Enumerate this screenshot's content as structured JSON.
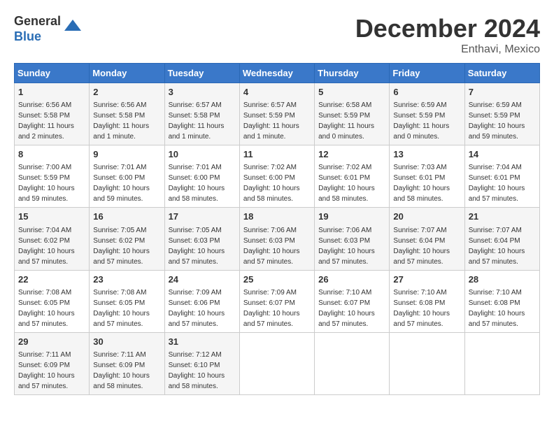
{
  "header": {
    "logo_general": "General",
    "logo_blue": "Blue",
    "month_title": "December 2024",
    "location": "Enthavi, Mexico"
  },
  "weekdays": [
    "Sunday",
    "Monday",
    "Tuesday",
    "Wednesday",
    "Thursday",
    "Friday",
    "Saturday"
  ],
  "weeks": [
    [
      {
        "day": "1",
        "sunrise": "6:56 AM",
        "sunset": "5:58 PM",
        "daylight": "11 hours and 2 minutes."
      },
      {
        "day": "2",
        "sunrise": "6:56 AM",
        "sunset": "5:58 PM",
        "daylight": "11 hours and 1 minute."
      },
      {
        "day": "3",
        "sunrise": "6:57 AM",
        "sunset": "5:58 PM",
        "daylight": "11 hours and 1 minute."
      },
      {
        "day": "4",
        "sunrise": "6:57 AM",
        "sunset": "5:59 PM",
        "daylight": "11 hours and 1 minute."
      },
      {
        "day": "5",
        "sunrise": "6:58 AM",
        "sunset": "5:59 PM",
        "daylight": "11 hours and 0 minutes."
      },
      {
        "day": "6",
        "sunrise": "6:59 AM",
        "sunset": "5:59 PM",
        "daylight": "11 hours and 0 minutes."
      },
      {
        "day": "7",
        "sunrise": "6:59 AM",
        "sunset": "5:59 PM",
        "daylight": "10 hours and 59 minutes."
      }
    ],
    [
      {
        "day": "8",
        "sunrise": "7:00 AM",
        "sunset": "5:59 PM",
        "daylight": "10 hours and 59 minutes."
      },
      {
        "day": "9",
        "sunrise": "7:01 AM",
        "sunset": "6:00 PM",
        "daylight": "10 hours and 59 minutes."
      },
      {
        "day": "10",
        "sunrise": "7:01 AM",
        "sunset": "6:00 PM",
        "daylight": "10 hours and 58 minutes."
      },
      {
        "day": "11",
        "sunrise": "7:02 AM",
        "sunset": "6:00 PM",
        "daylight": "10 hours and 58 minutes."
      },
      {
        "day": "12",
        "sunrise": "7:02 AM",
        "sunset": "6:01 PM",
        "daylight": "10 hours and 58 minutes."
      },
      {
        "day": "13",
        "sunrise": "7:03 AM",
        "sunset": "6:01 PM",
        "daylight": "10 hours and 58 minutes."
      },
      {
        "day": "14",
        "sunrise": "7:04 AM",
        "sunset": "6:01 PM",
        "daylight": "10 hours and 57 minutes."
      }
    ],
    [
      {
        "day": "15",
        "sunrise": "7:04 AM",
        "sunset": "6:02 PM",
        "daylight": "10 hours and 57 minutes."
      },
      {
        "day": "16",
        "sunrise": "7:05 AM",
        "sunset": "6:02 PM",
        "daylight": "10 hours and 57 minutes."
      },
      {
        "day": "17",
        "sunrise": "7:05 AM",
        "sunset": "6:03 PM",
        "daylight": "10 hours and 57 minutes."
      },
      {
        "day": "18",
        "sunrise": "7:06 AM",
        "sunset": "6:03 PM",
        "daylight": "10 hours and 57 minutes."
      },
      {
        "day": "19",
        "sunrise": "7:06 AM",
        "sunset": "6:03 PM",
        "daylight": "10 hours and 57 minutes."
      },
      {
        "day": "20",
        "sunrise": "7:07 AM",
        "sunset": "6:04 PM",
        "daylight": "10 hours and 57 minutes."
      },
      {
        "day": "21",
        "sunrise": "7:07 AM",
        "sunset": "6:04 PM",
        "daylight": "10 hours and 57 minutes."
      }
    ],
    [
      {
        "day": "22",
        "sunrise": "7:08 AM",
        "sunset": "6:05 PM",
        "daylight": "10 hours and 57 minutes."
      },
      {
        "day": "23",
        "sunrise": "7:08 AM",
        "sunset": "6:05 PM",
        "daylight": "10 hours and 57 minutes."
      },
      {
        "day": "24",
        "sunrise": "7:09 AM",
        "sunset": "6:06 PM",
        "daylight": "10 hours and 57 minutes."
      },
      {
        "day": "25",
        "sunrise": "7:09 AM",
        "sunset": "6:07 PM",
        "daylight": "10 hours and 57 minutes."
      },
      {
        "day": "26",
        "sunrise": "7:10 AM",
        "sunset": "6:07 PM",
        "daylight": "10 hours and 57 minutes."
      },
      {
        "day": "27",
        "sunrise": "7:10 AM",
        "sunset": "6:08 PM",
        "daylight": "10 hours and 57 minutes."
      },
      {
        "day": "28",
        "sunrise": "7:10 AM",
        "sunset": "6:08 PM",
        "daylight": "10 hours and 57 minutes."
      }
    ],
    [
      {
        "day": "29",
        "sunrise": "7:11 AM",
        "sunset": "6:09 PM",
        "daylight": "10 hours and 57 minutes."
      },
      {
        "day": "30",
        "sunrise": "7:11 AM",
        "sunset": "6:09 PM",
        "daylight": "10 hours and 58 minutes."
      },
      {
        "day": "31",
        "sunrise": "7:12 AM",
        "sunset": "6:10 PM",
        "daylight": "10 hours and 58 minutes."
      },
      null,
      null,
      null,
      null
    ]
  ],
  "labels": {
    "sunrise": "Sunrise:",
    "sunset": "Sunset:",
    "daylight": "Daylight hours"
  }
}
